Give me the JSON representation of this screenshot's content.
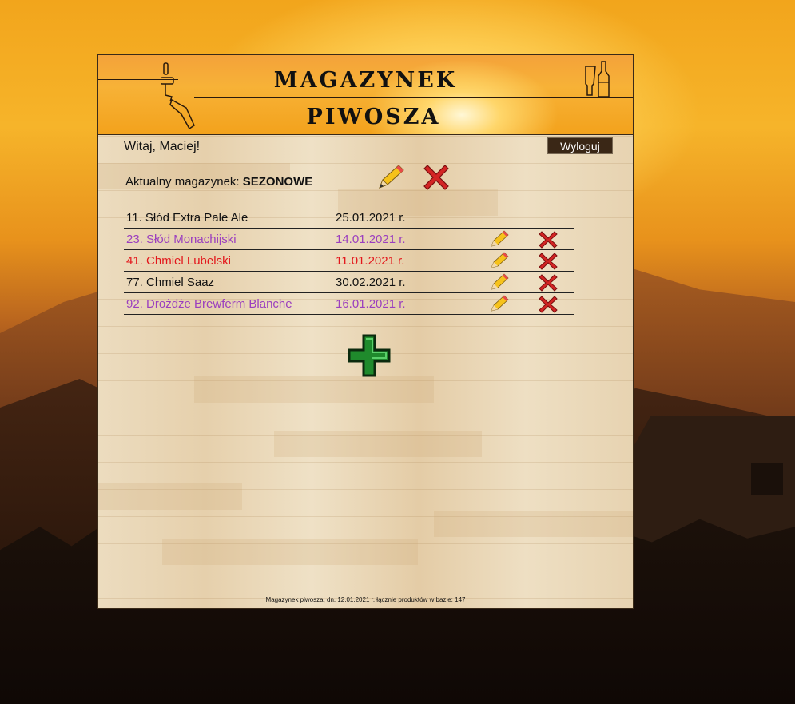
{
  "header": {
    "title_line1": "MAGAZYNEK",
    "title_line2": "PIWOSZA"
  },
  "user_bar": {
    "welcome": "Witaj, Maciej!",
    "logout_label": "Wyloguj"
  },
  "warehouse": {
    "label": "Aktualny magazynek:",
    "name": "SEZONOWE"
  },
  "products": [
    {
      "name": "11. Słód Extra Pale Ale",
      "date": "25.01.2021 r.",
      "color": "#111111",
      "actions": false
    },
    {
      "name": "23. Słód Monachijski",
      "date": "14.01.2021 r.",
      "color": "#9b3fbf",
      "actions": true
    },
    {
      "name": "41. Chmiel Lubelski",
      "date": "11.01.2021 r.",
      "color": "#e3161b",
      "actions": true
    },
    {
      "name": "77. Chmiel Saaz",
      "date": "30.02.2021 r.",
      "color": "#111111",
      "actions": true
    },
    {
      "name": "92. Drożdże Brewferm Blanche",
      "date": "16.01.2021 r.",
      "color": "#9b3fbf",
      "actions": true
    }
  ],
  "footer": {
    "text": "Magazynek piwosza, dn. 12.01.2021 r. łącznie produktów w bazie: 147"
  },
  "icons": {
    "edit": "pencil-icon",
    "delete": "red-x-icon",
    "add": "green-plus-icon",
    "tap": "beer-tap-icon",
    "glasses": "beer-glass-bottle-icon"
  },
  "colors": {
    "accent_purple": "#9b3fbf",
    "accent_red": "#e3161b",
    "logout_bg": "#3a2716"
  }
}
